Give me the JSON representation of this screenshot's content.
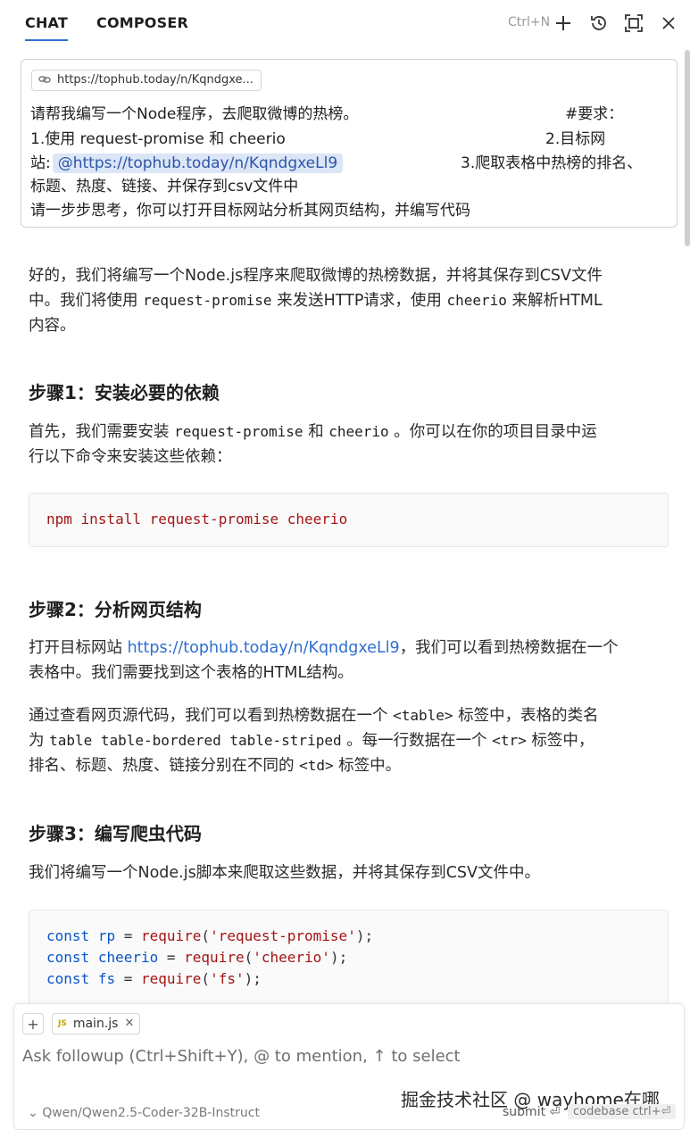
{
  "header": {
    "tabs": [
      "CHAT",
      "COMPOSER"
    ],
    "new_chat_shortcut": "Ctrl+N"
  },
  "user_message": {
    "url_chip": "https://tophub.today/n/Kqndgxe...",
    "line1_main": "请帮我编写一个Node程序，去爬取微博的热榜。",
    "line1_right": "#要求：",
    "line2_main": "1.使用 request-promise 和 cheerio",
    "line2_right": "2.目标网",
    "line3_prefix": "站:",
    "line3_mention": "@https://tophub.today/n/KqndgxeLl9",
    "line3_right": "3.爬取表格中热榜的排名、",
    "line4": "标题、热度、链接、并保存到csv文件中",
    "line5": "请一步步思考，你可以打开目标网站分析其网页结构，并编写代码"
  },
  "response": {
    "intro": {
      "l1": "好的，我们将编写一个Node.js程序来爬取微博的热榜数据，并将其保存到CSV文件",
      "l2_a": "中。我们将使用 ",
      "l2_code1": "request-promise",
      "l2_b": " 来发送HTTP请求，使用 ",
      "l2_code2": "cheerio",
      "l2_c": " 来解析HTML",
      "l3": "内容。"
    },
    "step1": {
      "heading": "步骤1：安装必要的依赖",
      "p1_a": "首先，我们需要安装 ",
      "p1_code1": "request-promise",
      "p1_b": " 和 ",
      "p1_code2": "cheerio",
      "p1_c": " 。你可以在你的项目目录中运",
      "p2": "行以下命令来安装这些依赖：",
      "code": [
        "npm",
        "install",
        "request-promise",
        "cheerio"
      ]
    },
    "step2": {
      "heading": "步骤2：分析网页结构",
      "p1_a": "打开目标网站 ",
      "p1_link": "https://tophub.today/n/KqndgxeLl9",
      "p1_b": "，我们可以看到热榜数据在一个",
      "p2": "表格中。我们需要找到这个表格的HTML结构。",
      "p3_a": "通过查看网页源代码，我们可以看到热榜数据在一个 ",
      "p3_code": "<table>",
      "p3_b": " 标签中，表格的类名",
      "p4_a": "为 ",
      "p4_code": "table table-bordered table-striped",
      "p4_b": " 。每一行数据在一个 ",
      "p4_code2": "<tr>",
      "p4_c": " 标签中，",
      "p5_a": "排名、标题、热度、链接分别在不同的 ",
      "p5_code": "<td>",
      "p5_b": " 标签中。"
    },
    "step3": {
      "heading": "步骤3：编写爬虫代码",
      "p1": "我们将编写一个Node.js脚本来爬取这些数据，并将其保存到CSV文件中。",
      "code": [
        {
          "kw": "const",
          "var": "rp",
          "fn": "require",
          "arg": "'request-promise'"
        },
        {
          "kw": "const",
          "var": "cheerio",
          "fn": "require",
          "arg": "'cheerio'"
        },
        {
          "kw": "const",
          "var": "fs",
          "fn": "require",
          "arg": "'fs'"
        }
      ]
    }
  },
  "input": {
    "add_label": "+",
    "file_chip": "main.js",
    "file_chip_badge": "JS",
    "placeholder": "Ask followup (Ctrl+Shift+Y), @ to mention, ↑ to select",
    "model": "Qwen/Qwen2.5-Coder-32B-Instruct",
    "submit": "submit ⏎",
    "codebase": "codebase ctrl+⏎",
    "watermark": "掘金技术社区 @ wayhome在哪"
  },
  "colors": {
    "accent": "#2f6fd0",
    "mention_bg": "#dbe6f6",
    "string": "#a31515",
    "keyword": "#0b55c8"
  }
}
